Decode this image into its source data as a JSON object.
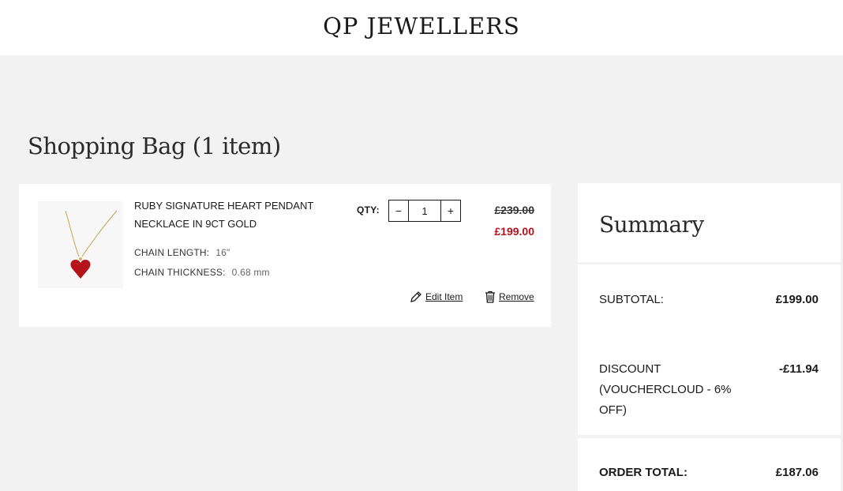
{
  "header": {
    "brand": "QP JEWELLERS"
  },
  "page": {
    "title": "Shopping Bag (1 item)"
  },
  "item": {
    "name": "RUBY SIGNATURE HEART PENDANT NECKLACE IN 9CT GOLD",
    "attributes": [
      {
        "label": "CHAIN LENGTH:",
        "value": "16\""
      },
      {
        "label": "CHAIN THICKNESS:",
        "value": "0.68 mm"
      }
    ],
    "qty_label": "QTY:",
    "qty_minus": "−",
    "qty_value": "1",
    "qty_plus": "+",
    "price_old": "£239.00",
    "price_new": "£199.00",
    "edit_label": "Edit Item",
    "remove_label": "Remove",
    "thumbnail_icon": "ruby-heart-necklace-image"
  },
  "summary": {
    "title": "Summary",
    "subtotal_label": "SUBTOTAL:",
    "subtotal_value": "£199.00",
    "discount_label": "DISCOUNT (VOUCHERCLOUD - 6% OFF)",
    "discount_value": "-£11.94",
    "total_label": "ORDER TOTAL:",
    "total_value": "£187.06"
  },
  "colors": {
    "sale_price": "#b5121b",
    "background": "#f2f2f2",
    "panel": "#ffffff"
  }
}
